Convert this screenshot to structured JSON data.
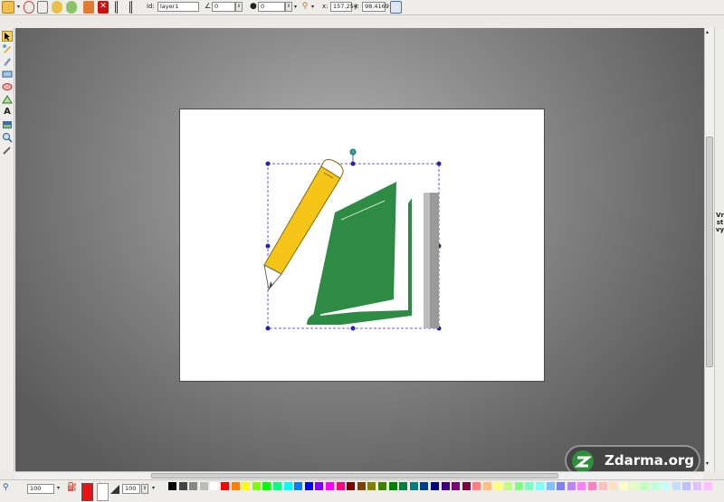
{
  "toolbar": {
    "id_label": "id:",
    "id_value": "layer1",
    "angle_value": "0",
    "stroke_value": "0",
    "x_label": "x:",
    "x_value": "157.254",
    "y_label": "y:",
    "y_value": "98.4169",
    "icons": [
      "paint-icon",
      "globe-icon",
      "copy-icon",
      "undo-icon",
      "redo-icon",
      "download-icon",
      "delete-icon",
      "align-icon",
      "list-icon",
      "angle-icon",
      "stroke-icon",
      "pin-icon",
      "grid-icon"
    ]
  },
  "tools": [
    "select-arrow",
    "node-edit",
    "pencil",
    "rectangle",
    "ellipse",
    "polygon",
    "text",
    "image",
    "zoom",
    "eyedropper"
  ],
  "sidebar": {
    "layers_label": "Vrstvy"
  },
  "status": {
    "zoom_value": "100",
    "opacity_value": "100"
  },
  "palette": [
    "#000000",
    "#444444",
    "#888888",
    "#bbbbbb",
    "#ffffff",
    "#ff0000",
    "#ff8000",
    "#ffff00",
    "#80ff00",
    "#00ff00",
    "#00ff80",
    "#00ffff",
    "#0080ff",
    "#0000ff",
    "#8000ff",
    "#ff00ff",
    "#ff0080",
    "#800000",
    "#804000",
    "#808000",
    "#408000",
    "#008000",
    "#008040",
    "#008080",
    "#004080",
    "#000080",
    "#400080",
    "#800080",
    "#800040",
    "#ff8080",
    "#ffc080",
    "#ffff80",
    "#c0ff80",
    "#80ff80",
    "#80ffc0",
    "#80ffff",
    "#80c0ff",
    "#8080ff",
    "#c080ff",
    "#ff80ff",
    "#ff80c0",
    "#ffc0c0",
    "#ffe0c0",
    "#ffffc0",
    "#e0ffc0",
    "#c0ffc0",
    "#c0ffe0",
    "#c0ffff",
    "#c0e0ff",
    "#c0c0ff",
    "#e0c0ff",
    "#ffc0ff"
  ],
  "colors": {
    "fill": "#ee1111",
    "book": "#2e8b43",
    "pencil": "#f5c518",
    "selection": "#3333cc"
  },
  "watermark": {
    "text": "Zdarma.org"
  }
}
